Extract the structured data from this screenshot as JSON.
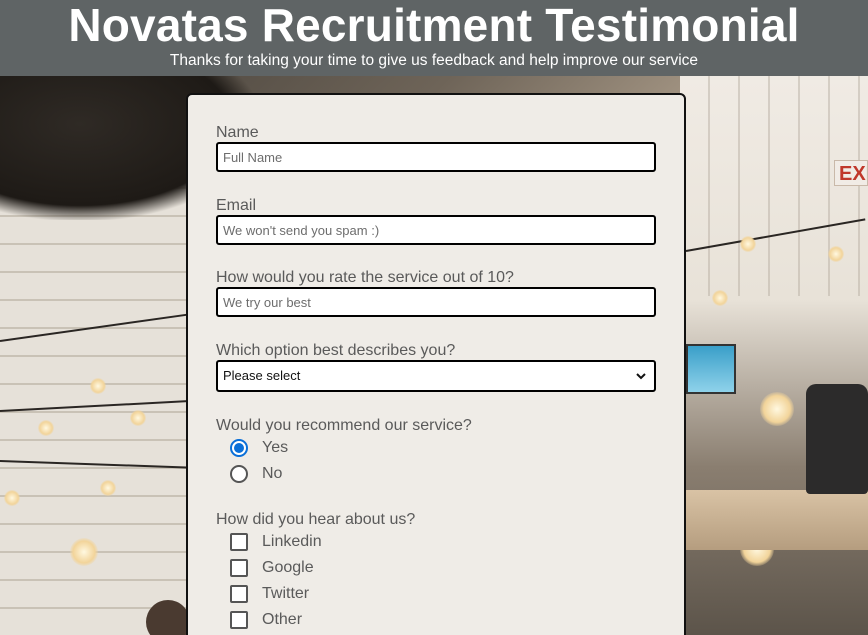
{
  "header": {
    "title": "Novatas Recruitment Testimonial",
    "subtitle": "Thanks for taking your time to give us feedback and help improve our service"
  },
  "form": {
    "name": {
      "label": "Name",
      "placeholder": "Full Name",
      "value": ""
    },
    "email": {
      "label": "Email",
      "placeholder": "We won't send you spam :)",
      "value": ""
    },
    "rating": {
      "label": "How would you rate the service out of 10?",
      "placeholder": "We try our best",
      "value": ""
    },
    "role": {
      "label": "Which option best describes you?",
      "selected": "Please select"
    },
    "recommend": {
      "label": "Would you recommend our service?",
      "options": [
        {
          "label": "Yes",
          "checked": true
        },
        {
          "label": "No",
          "checked": false
        }
      ]
    },
    "source": {
      "label": "How did you hear about us?",
      "options": [
        {
          "label": "Linkedin",
          "checked": false
        },
        {
          "label": "Google",
          "checked": false
        },
        {
          "label": "Twitter",
          "checked": false
        },
        {
          "label": "Other",
          "checked": false
        }
      ]
    }
  },
  "background": {
    "exit_sign": "EXIT"
  },
  "colors": {
    "header_bg": "#5f6465",
    "card_bg": "#efece7",
    "radio_accent": "#0a6fd8"
  }
}
